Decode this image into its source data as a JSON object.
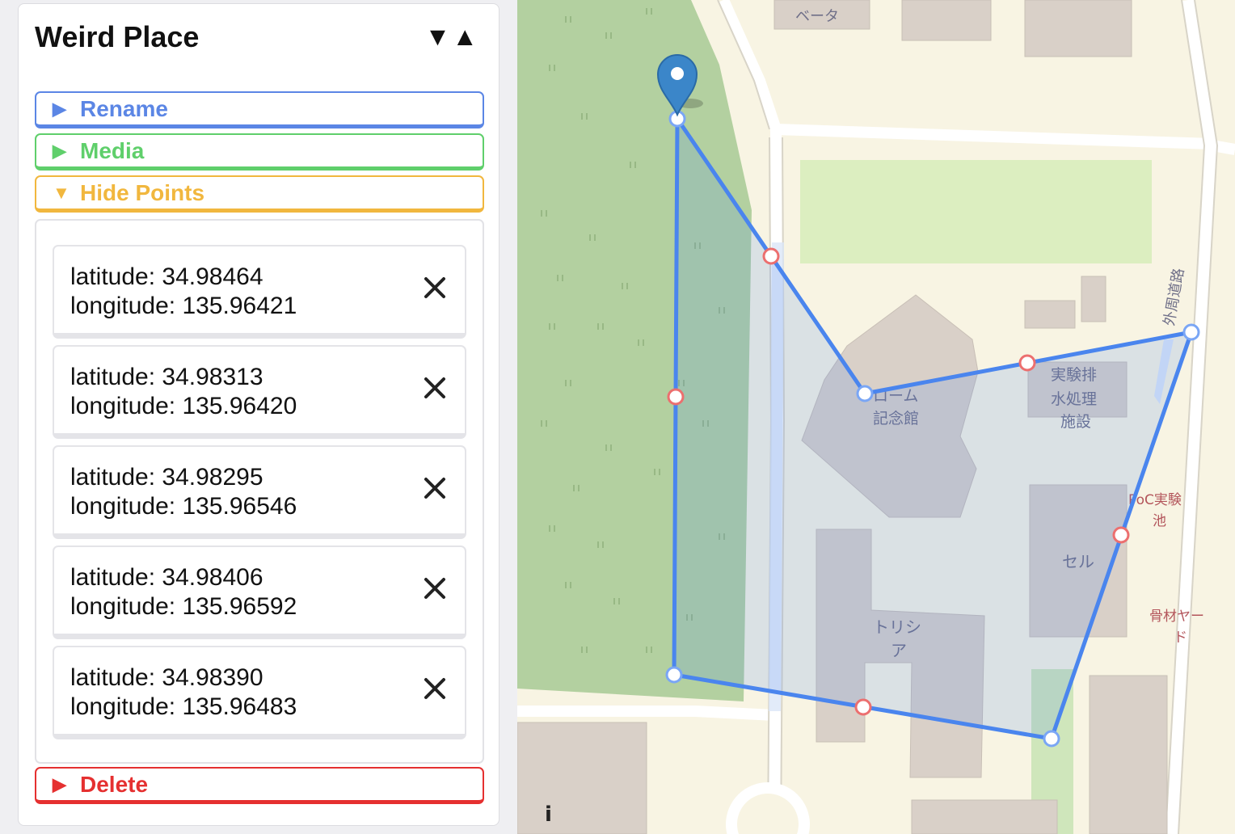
{
  "panel": {
    "title": "Weird Place",
    "reorder_icon": "▼▲",
    "buttons": {
      "rename": {
        "label": "Rename",
        "icon": "▶",
        "color": "#5b86e5"
      },
      "media": {
        "label": "Media",
        "icon": "▶",
        "color": "#5fcf6b"
      },
      "hide_points": {
        "label": "Hide Points",
        "icon": "▼",
        "color": "#f1b73e"
      },
      "delete": {
        "label": "Delete",
        "icon": "▶",
        "color": "#e53030"
      }
    },
    "points": [
      {
        "lat": "latitude: 34.98464",
        "lng": "longitude: 135.96421"
      },
      {
        "lat": "latitude: 34.98313",
        "lng": "longitude: 135.96420"
      },
      {
        "lat": "latitude: 34.98295",
        "lng": "longitude: 135.96546"
      },
      {
        "lat": "latitude: 34.98406",
        "lng": "longitude: 135.96592"
      },
      {
        "lat": "latitude: 34.98390",
        "lng": "longitude: 135.96483"
      }
    ]
  },
  "map": {
    "labels": {
      "beta": "ベータ",
      "rohm1": "ローム",
      "rohm2": "記念館",
      "jikken1": "実験排",
      "jikken2": "水処理",
      "jikken3": "施設",
      "cell": "セル",
      "torisia1": "トリシ",
      "torisia2": "ア",
      "gaishu": "外周道路",
      "poc1": "PoC実験",
      "poc2": "池",
      "kotsu1": "骨材ヤー",
      "kotsu2": "ド"
    },
    "colors": {
      "polygon_stroke": "#4a85ee",
      "vertex_stroke": "#7aa6f5",
      "midpoint_stroke": "#ec6f6f",
      "forest": "#b3d0a0",
      "building": "#d9d0c8"
    }
  }
}
